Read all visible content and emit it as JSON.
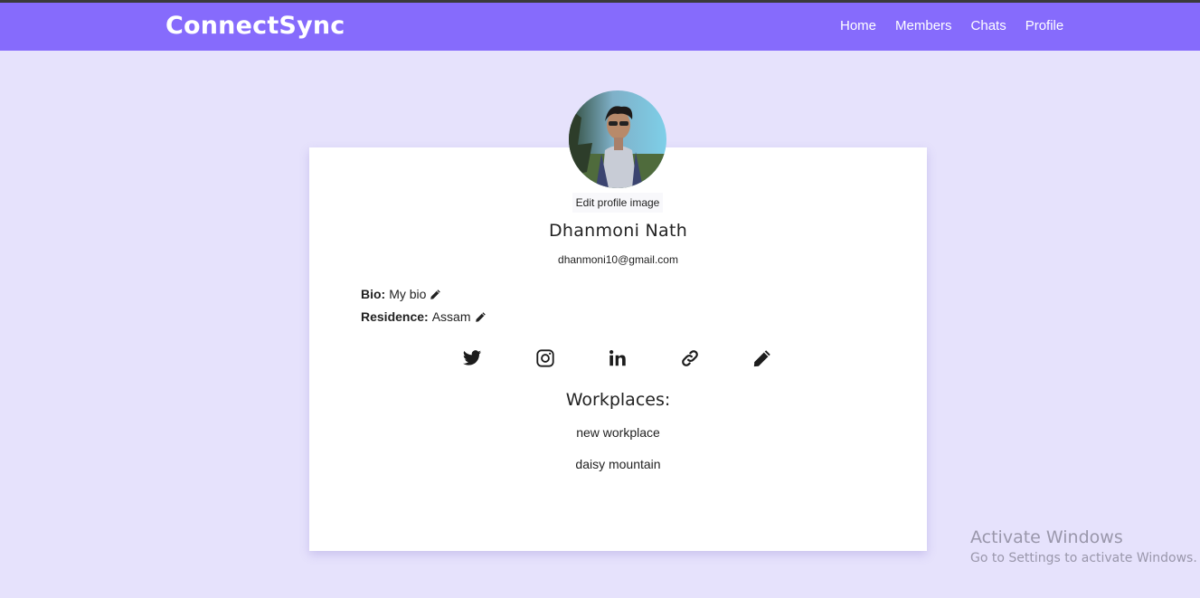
{
  "navbar": {
    "brand": "ConnectSync",
    "links": [
      {
        "label": "Home"
      },
      {
        "label": "Members"
      },
      {
        "label": "Chats"
      },
      {
        "label": "Profile"
      }
    ]
  },
  "profile": {
    "edit_image_label": "Edit profile image",
    "name": "Dhanmoni Nath",
    "email": "dhanmoni10@gmail.com",
    "bio_label": "Bio:",
    "bio_value": "My bio",
    "residence_label": "Residence:",
    "residence_value": "Assam"
  },
  "socials": [
    {
      "icon": "twitter-icon"
    },
    {
      "icon": "instagram-icon"
    },
    {
      "icon": "linkedin-icon"
    },
    {
      "icon": "link-icon"
    },
    {
      "icon": "pencil-icon"
    }
  ],
  "workplaces": {
    "title": "Workplaces:",
    "items": [
      "new workplace",
      "daisy mountain"
    ]
  },
  "watermark": {
    "line1": "Activate Windows",
    "line2": "Go to Settings to activate Windows."
  },
  "colors": {
    "navbar": "#866bfc",
    "background": "#e6e2fc",
    "card": "#ffffff"
  }
}
